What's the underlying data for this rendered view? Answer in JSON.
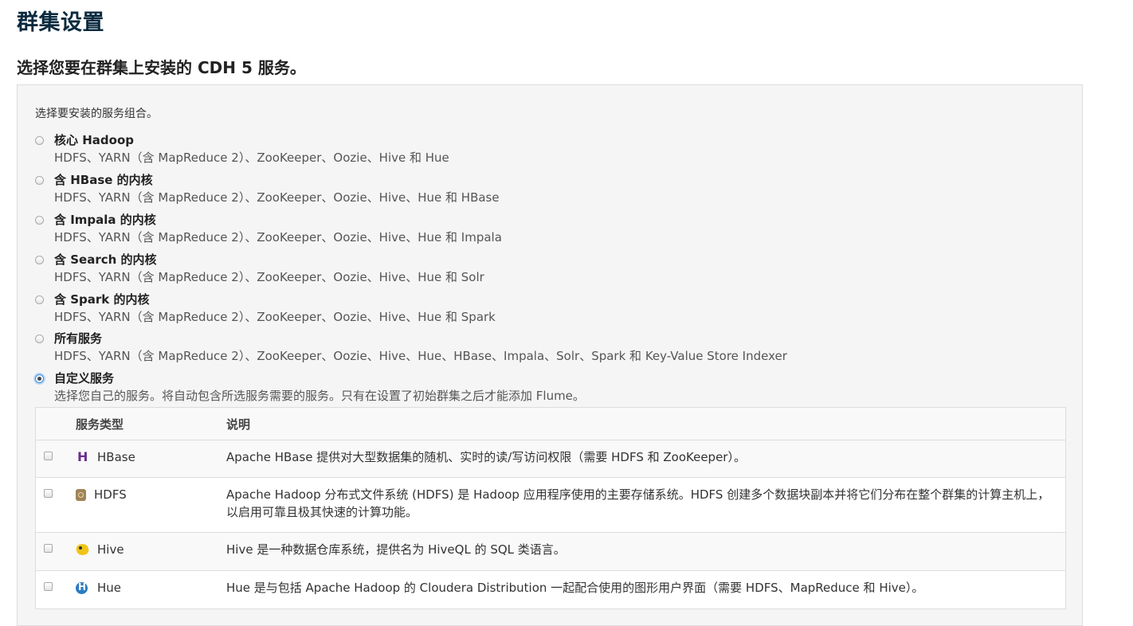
{
  "page": {
    "title": "群集设置",
    "heading": "选择您要在群集上安装的 CDH 5 服务。"
  },
  "panel": {
    "instruction": "选择要安装的服务组合。",
    "options": [
      {
        "title": "核心 Hadoop",
        "desc": "HDFS、YARN（含 MapReduce 2）、ZooKeeper、Oozie、Hive 和 Hue",
        "selected": false
      },
      {
        "title": "含 HBase 的内核",
        "desc": "HDFS、YARN（含 MapReduce 2）、ZooKeeper、Oozie、Hive、Hue 和 HBase",
        "selected": false
      },
      {
        "title": "含 Impala 的内核",
        "desc": "HDFS、YARN（含 MapReduce 2）、ZooKeeper、Oozie、Hive、Hue 和 Impala",
        "selected": false
      },
      {
        "title": "含 Search 的内核",
        "desc": "HDFS、YARN（含 MapReduce 2）、ZooKeeper、Oozie、Hive、Hue 和 Solr",
        "selected": false
      },
      {
        "title": "含 Spark 的内核",
        "desc": "HDFS、YARN（含 MapReduce 2）、ZooKeeper、Oozie、Hive、Hue 和 Spark",
        "selected": false
      },
      {
        "title": "所有服务",
        "desc": "HDFS、YARN（含 MapReduce 2）、ZooKeeper、Oozie、Hive、Hue、HBase、Impala、Solr、Spark 和 Key-Value Store Indexer",
        "selected": false
      },
      {
        "title": "自定义服务",
        "desc": "选择您自己的服务。将自动包含所选服务需要的服务。只有在设置了初始群集之后才能添加 Flume。",
        "selected": true
      }
    ]
  },
  "table": {
    "headers": {
      "type": "服务类型",
      "description": "说明"
    },
    "rows": [
      {
        "name": "HBase",
        "icon": "hbase-icon",
        "desc": "Apache HBase 提供对大型数据集的随机、实时的读/写访问权限（需要 HDFS 和 ZooKeeper）。",
        "checked": false
      },
      {
        "name": "HDFS",
        "icon": "hdfs-icon",
        "desc": "Apache Hadoop 分布式文件系统 (HDFS) 是 Hadoop 应用程序使用的主要存储系统。HDFS 创建多个数据块副本并将它们分布在整个群集的计算主机上，以启用可靠且极其快速的计算功能。",
        "checked": false
      },
      {
        "name": "Hive",
        "icon": "hive-icon",
        "desc": "Hive 是一种数据仓库系统，提供名为 HiveQL 的 SQL 类语言。",
        "checked": false
      },
      {
        "name": "Hue",
        "icon": "hue-icon",
        "desc": "Hue 是与包括 Apache Hadoop 的 Cloudera Distribution 一起配合使用的图形用户界面（需要 HDFS、MapReduce 和 Hive）。",
        "checked": false
      }
    ]
  }
}
